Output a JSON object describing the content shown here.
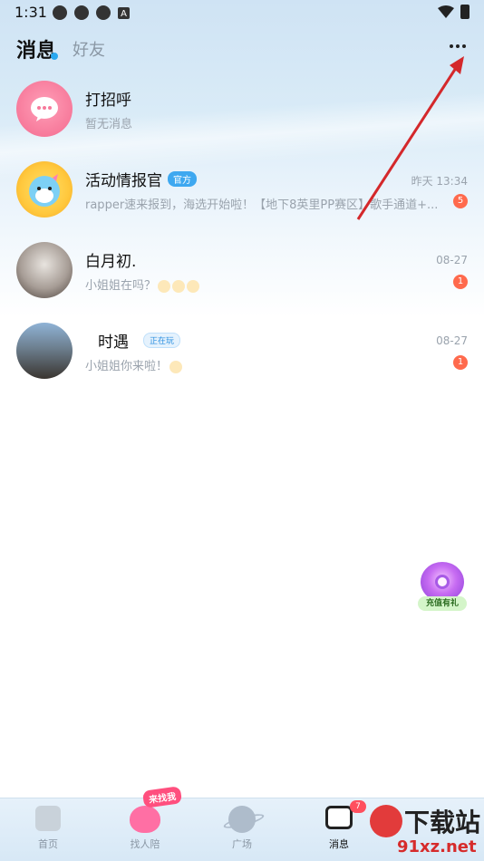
{
  "status_bar": {
    "time": "1:31",
    "icons": [
      "app-icon",
      "app-icon",
      "app-icon",
      "a-icon",
      "wifi-icon",
      "battery-icon"
    ]
  },
  "header": {
    "tabs": [
      {
        "label": "消息",
        "active": true
      },
      {
        "label": "好友",
        "active": false
      }
    ],
    "more_icon": "more-icon"
  },
  "messages": [
    {
      "name": "打招呼",
      "badge": "",
      "preview": "暂无消息",
      "time": "",
      "unread": ""
    },
    {
      "name": "活动情报官",
      "badge": "官方",
      "preview": "rapper速来报到，海选开始啦！【地下8英里PP赛区】歌手通道+...",
      "time": "昨天 13:34",
      "unread": "5"
    },
    {
      "name": "白月初.",
      "badge": "",
      "preview": "小姐姐在吗？",
      "time": "08-27",
      "unread": "1"
    },
    {
      "name": "时遇",
      "badge": "正在玩",
      "preview": "小姐姐你来啦！",
      "time": "08-27",
      "unread": "1"
    }
  ],
  "floating_gift": {
    "label": "充值有礼"
  },
  "bottom_nav": {
    "items": [
      {
        "label": "首页",
        "icon": "home-icon"
      },
      {
        "label": "找人陪",
        "icon": "heart-icon"
      },
      {
        "label": "广场",
        "icon": "planet-icon"
      },
      {
        "label": "消息",
        "icon": "message-icon"
      }
    ],
    "promo_tag": "来找我",
    "message_badge": "7"
  },
  "watermark": {
    "title": "下载站",
    "url": "91xz.net"
  },
  "colors": {
    "accent": "#3ea8f0",
    "unread": "#ff6a4d",
    "arrow": "#d4282b"
  }
}
